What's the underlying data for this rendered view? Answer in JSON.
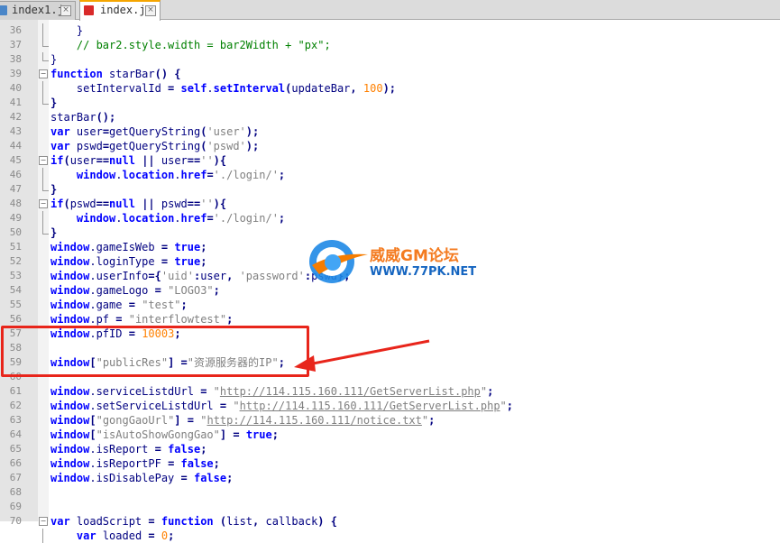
{
  "tabs": [
    {
      "name": "index1.js",
      "close": "×"
    },
    {
      "name": "index.js",
      "close": "×"
    }
  ],
  "lines": [
    {
      "n": "36",
      "fold": "bar",
      "html": "    }"
    },
    {
      "n": "37",
      "fold": "end",
      "html": "    <span class=\"cmt\">// bar2.style.width = bar2Width + \"px\";</span>"
    },
    {
      "n": "38",
      "fold": "end",
      "html": "}"
    },
    {
      "n": "39",
      "fold": "box",
      "html": "<span class=\"kw\">function</span> starBar<span class=\"op\">()</span> <span class=\"op\">{</span>"
    },
    {
      "n": "40",
      "fold": "bar",
      "html": "    setIntervalId <span class=\"op\">=</span> <span class=\"kw\">self</span>.<span class=\"kw\">setInterval</span><span class=\"op\">(</span>updateBar<span class=\"op\">,</span> <span class=\"num\">100</span><span class=\"op\">);</span>"
    },
    {
      "n": "41",
      "fold": "end",
      "html": "<span class=\"op\">}</span>"
    },
    {
      "n": "42",
      "fold": "",
      "html": "starBar<span class=\"op\">();</span>"
    },
    {
      "n": "43",
      "fold": "",
      "html": "<span class=\"kw\">var</span> user<span class=\"op\">=</span>getQueryString<span class=\"op\">(</span><span class=\"str\">'user'</span><span class=\"op\">);</span>"
    },
    {
      "n": "44",
      "fold": "",
      "html": "<span class=\"kw\">var</span> pswd<span class=\"op\">=</span>getQueryString<span class=\"op\">(</span><span class=\"str\">'pswd'</span><span class=\"op\">);</span>"
    },
    {
      "n": "45",
      "fold": "box",
      "html": "<span class=\"kw\">if</span><span class=\"op\">(</span>user<span class=\"op\">==</span><span class=\"kw\">null</span> <span class=\"op\">||</span> user<span class=\"op\">==</span><span class=\"str\">''</span><span class=\"op\">){</span>"
    },
    {
      "n": "46",
      "fold": "bar",
      "html": "    <span class=\"kw\">window</span>.<span class=\"kw\">location</span>.<span class=\"kw\">href</span><span class=\"op\">=</span><span class=\"str\">'./login/'</span><span class=\"op\">;</span>"
    },
    {
      "n": "47",
      "fold": "end",
      "html": "<span class=\"op\">}</span>"
    },
    {
      "n": "48",
      "fold": "box",
      "html": "<span class=\"kw\">if</span><span class=\"op\">(</span>pswd<span class=\"op\">==</span><span class=\"kw\">null</span> <span class=\"op\">||</span> pswd<span class=\"op\">==</span><span class=\"str\">''</span><span class=\"op\">){</span>"
    },
    {
      "n": "49",
      "fold": "bar",
      "html": "    <span class=\"kw\">window</span>.<span class=\"kw\">location</span>.<span class=\"kw\">href</span><span class=\"op\">=</span><span class=\"str\">'./login/'</span><span class=\"op\">;</span>"
    },
    {
      "n": "50",
      "fold": "end",
      "html": "<span class=\"op\">}</span>"
    },
    {
      "n": "51",
      "fold": "",
      "html": "<span class=\"kw\">window</span>.gameIsWeb <span class=\"op\">=</span> <span class=\"kw\">true</span><span class=\"op\">;</span>"
    },
    {
      "n": "52",
      "fold": "",
      "html": "<span class=\"kw\">window</span>.loginType <span class=\"op\">=</span> <span class=\"kw\">true</span><span class=\"op\">;</span>"
    },
    {
      "n": "53",
      "fold": "",
      "html": "<span class=\"kw\">window</span>.userInfo<span class=\"op\">={</span><span class=\"str\">'uid'</span><span class=\"op\">:</span>user<span class=\"op\">,</span> <span class=\"str\">'password'</span><span class=\"op\">:</span>pswd<span class=\"op\">};</span>"
    },
    {
      "n": "54",
      "fold": "",
      "html": "<span class=\"kw\">window</span>.gameLogo <span class=\"op\">=</span> <span class=\"str\">\"LOGO3\"</span><span class=\"op\">;</span>"
    },
    {
      "n": "55",
      "fold": "",
      "html": "<span class=\"kw\">window</span>.game <span class=\"op\">=</span> <span class=\"str\">\"test\"</span><span class=\"op\">;</span>"
    },
    {
      "n": "56",
      "fold": "",
      "html": "<span class=\"kw\">window</span>.pf <span class=\"op\">=</span> <span class=\"str\">\"interflowtest\"</span><span class=\"op\">;</span>"
    },
    {
      "n": "57",
      "fold": "",
      "html": "<span class=\"kw\">window</span>.pfID <span class=\"op\">=</span> <span class=\"num\">10003</span><span class=\"op\">;</span>"
    },
    {
      "n": "58",
      "fold": "",
      "html": ""
    },
    {
      "n": "59",
      "fold": "",
      "html": "<span class=\"kw\">window</span><span class=\"op\">[</span><span class=\"str\">\"publicRes\"</span><span class=\"op\">]</span> <span class=\"op\">=</span><span class=\"str\">\"资源服务器的IP\"</span><span class=\"op\">;</span>"
    },
    {
      "n": "60",
      "fold": "",
      "html": ""
    },
    {
      "n": "61",
      "fold": "",
      "html": "<span class=\"kw\">window</span>.serviceListdUrl <span class=\"op\">=</span> <span class=\"str\">\"</span><span class=\"url\">http://114.115.160.111/GetServerList.php</span><span class=\"str\">\"</span><span class=\"op\">;</span>"
    },
    {
      "n": "62",
      "fold": "",
      "html": "<span class=\"kw\">window</span>.setServiceListdUrl <span class=\"op\">=</span> <span class=\"str\">\"</span><span class=\"url\">http://114.115.160.111/GetServerList.php</span><span class=\"str\">\"</span><span class=\"op\">;</span>"
    },
    {
      "n": "63",
      "fold": "",
      "html": "<span class=\"kw\">window</span><span class=\"op\">[</span><span class=\"str\">\"gongGaoUrl\"</span><span class=\"op\">]</span> <span class=\"op\">=</span> <span class=\"str\">\"</span><span class=\"url\">http://114.115.160.111/notice.txt</span><span class=\"str\">\"</span><span class=\"op\">;</span>"
    },
    {
      "n": "64",
      "fold": "",
      "html": "<span class=\"kw\">window</span><span class=\"op\">[</span><span class=\"str\">\"isAutoShowGongGao\"</span><span class=\"op\">]</span> <span class=\"op\">=</span> <span class=\"kw\">true</span><span class=\"op\">;</span>"
    },
    {
      "n": "65",
      "fold": "",
      "html": "<span class=\"kw\">window</span>.isReport <span class=\"op\">=</span> <span class=\"kw\">false</span><span class=\"op\">;</span>"
    },
    {
      "n": "66",
      "fold": "",
      "html": "<span class=\"kw\">window</span>.isReportPF <span class=\"op\">=</span> <span class=\"kw\">false</span><span class=\"op\">;</span>"
    },
    {
      "n": "67",
      "fold": "",
      "html": "<span class=\"kw\">window</span>.isDisablePay <span class=\"op\">=</span> <span class=\"kw\">false</span><span class=\"op\">;</span>"
    },
    {
      "n": "68",
      "fold": "",
      "html": ""
    },
    {
      "n": "69",
      "fold": "",
      "html": ""
    },
    {
      "n": "70",
      "fold": "box",
      "html": "<span class=\"kw\">var</span> loadScript <span class=\"op\">=</span> <span class=\"kw\">function</span> <span class=\"op\">(</span>list<span class=\"op\">,</span> callback<span class=\"op\">)</span> <span class=\"op\">{</span>"
    },
    {
      "n": "",
      "fold": "bar",
      "html": "    <span class=\"kw\">var</span> loaded <span class=\"op\">=</span> <span class=\"num\">0</span><span class=\"op\">;</span>"
    }
  ],
  "watermark": {
    "title": "威威GM论坛",
    "url": "WWW.77PK.NET"
  },
  "colors": {
    "highlight": "#e8251b",
    "keyword": "#0000ff",
    "string": "#808080",
    "number": "#ff8000",
    "comment": "#008000"
  }
}
